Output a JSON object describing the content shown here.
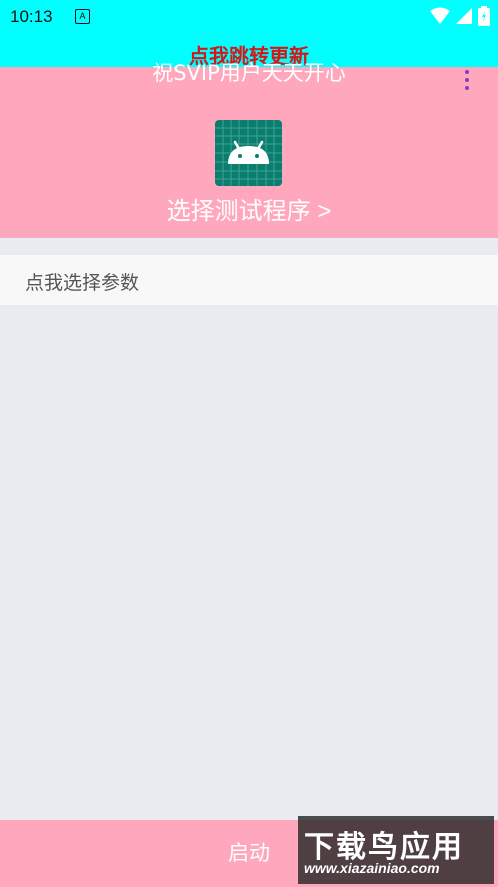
{
  "status_bar": {
    "time": "10:13",
    "notification_icon": "A",
    "icons": [
      "wifi-icon",
      "signal-icon",
      "battery-icon"
    ],
    "background": "#00ffff"
  },
  "update_link": "点我跳转更新",
  "header": {
    "title": "祝SVIP用户天天开心",
    "menu_icon": "more-vert-icon",
    "app_icon": "android-icon",
    "select_program": "选择测试程序 >",
    "background": "#ffa8bd"
  },
  "params": {
    "label": "点我选择参数"
  },
  "bottom": {
    "start_label": "启动"
  },
  "watermark": {
    "main": "下载鸟应用",
    "url": "www.xiazainiao.com"
  }
}
